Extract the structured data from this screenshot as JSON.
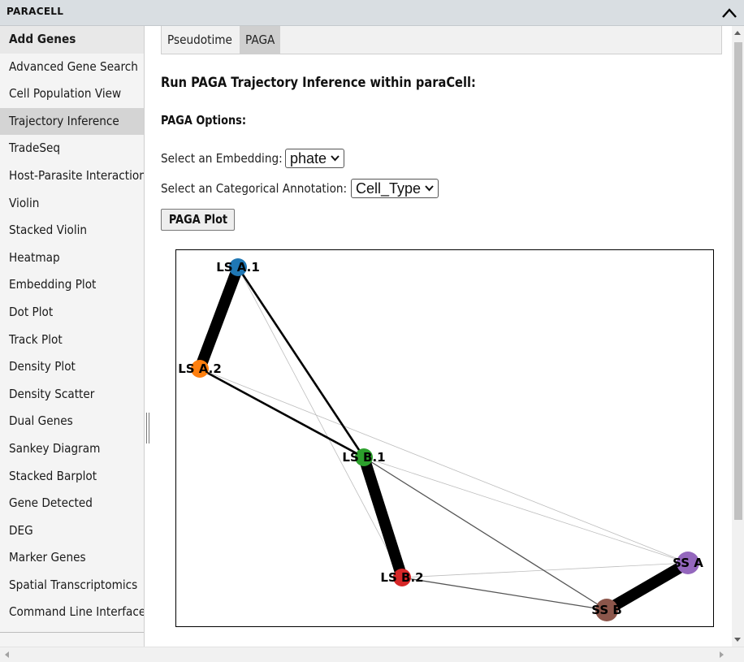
{
  "app": {
    "title": "PARACELL"
  },
  "sidebar": {
    "items": [
      {
        "label": "Add Genes",
        "kind": "header"
      },
      {
        "label": "Advanced Gene Search"
      },
      {
        "label": "Cell Population View"
      },
      {
        "label": "Trajectory Inference",
        "active": true
      },
      {
        "label": "TradeSeq"
      },
      {
        "label": "Host-Parasite Interactions"
      },
      {
        "label": "Violin"
      },
      {
        "label": "Stacked Violin"
      },
      {
        "label": "Heatmap"
      },
      {
        "label": "Embedding Plot"
      },
      {
        "label": "Dot Plot"
      },
      {
        "label": "Track Plot"
      },
      {
        "label": "Density Plot"
      },
      {
        "label": "Density Scatter"
      },
      {
        "label": "Dual Genes"
      },
      {
        "label": "Sankey Diagram"
      },
      {
        "label": "Stacked Barplot"
      },
      {
        "label": "Gene Detected"
      },
      {
        "label": "DEG"
      },
      {
        "label": "Marker Genes"
      },
      {
        "label": "Spatial Transcriptomics"
      },
      {
        "label": "Command Line Interface"
      }
    ]
  },
  "tabs": [
    {
      "label": "Pseudotime"
    },
    {
      "label": "PAGA",
      "active": true
    }
  ],
  "main": {
    "heading": "Run PAGA Trajectory Inference within paraCell:",
    "options_heading": "PAGA Options:",
    "embedding": {
      "label": "Select an Embedding:",
      "value": "phate"
    },
    "annotation": {
      "label": "Select an Categorical Annotation:",
      "value": "Cell_Type"
    },
    "plot_button": "PAGA Plot"
  },
  "paga_graph": {
    "nodes": [
      {
        "label": "LS A.1",
        "color": "#1f77b4"
      },
      {
        "label": "LS A.2",
        "color": "#ff7f0e"
      },
      {
        "label": "LS B.1",
        "color": "#2ca02c"
      },
      {
        "label": "LS B.2",
        "color": "#d62728"
      },
      {
        "label": "SS A",
        "color": "#9467bd"
      },
      {
        "label": "SS B",
        "color": "#8c564b"
      }
    ],
    "edges": [
      {
        "from": "LS A.1",
        "to": "LS A.2",
        "weight": "strong"
      },
      {
        "from": "LS B.1",
        "to": "LS B.2",
        "weight": "strong"
      },
      {
        "from": "SS A",
        "to": "SS B",
        "weight": "strong"
      },
      {
        "from": "LS A.2",
        "to": "LS B.1",
        "weight": "medium"
      },
      {
        "from": "LS A.1",
        "to": "LS B.1",
        "weight": "medium"
      },
      {
        "from": "LS B.1",
        "to": "SS B",
        "weight": "weak"
      },
      {
        "from": "LS B.2",
        "to": "SS B",
        "weight": "weak"
      },
      {
        "from": "LS B.1",
        "to": "SS A",
        "weight": "faint"
      },
      {
        "from": "LS B.2",
        "to": "SS A",
        "weight": "faint"
      },
      {
        "from": "LS A.2",
        "to": "SS A",
        "weight": "faint"
      },
      {
        "from": "LS A.1",
        "to": "LS B.2",
        "weight": "faint"
      }
    ]
  }
}
